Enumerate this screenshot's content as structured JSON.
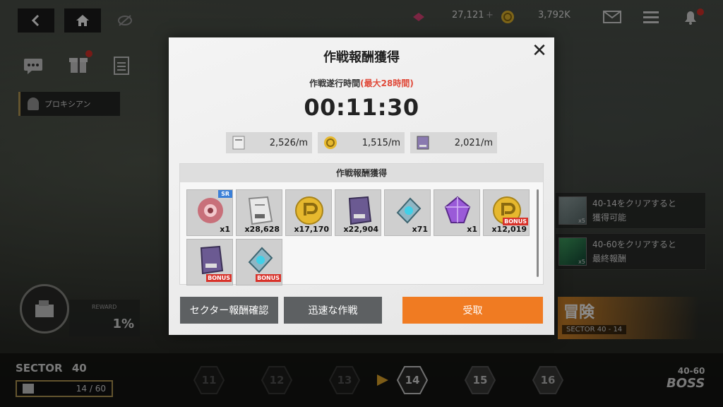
{
  "topbar": {
    "gem_amount": "27,121",
    "plus": "+",
    "credit_amount": "3,792K"
  },
  "side": {
    "proxy_label": "プロキシアン"
  },
  "reward_panel": {
    "label": "REWARD",
    "percent": "1%"
  },
  "missions": [
    {
      "text_line1": "40-14をクリアすると",
      "text_line2": "獲得可能",
      "count": "x5"
    },
    {
      "text_line1": "40-60をクリアすると",
      "text_line2": "最終報酬",
      "count": "x5"
    }
  ],
  "adventure": {
    "title": "冒険",
    "sector": "SECTOR 40 - 14"
  },
  "sector": {
    "label": "SECTOR",
    "number": "40",
    "progress": "14 / 60",
    "stages": [
      "11",
      "12",
      "13",
      "14",
      "15",
      "16"
    ],
    "boss_range": "40-60",
    "boss_label": "BOSS"
  },
  "modal": {
    "title": "作戦報酬獲得",
    "time_caption": "作戦遂行時間",
    "time_max": "(最大28時間)",
    "timer": "00:11:30",
    "rates": [
      {
        "icon": "exp-book-icon",
        "value": "2,526/m"
      },
      {
        "icon": "credit-coin-icon",
        "value": "1,515/m"
      },
      {
        "icon": "character-exp-icon",
        "value": "2,021/m"
      }
    ],
    "rewards_header": "作戦報酬獲得",
    "items": [
      {
        "icon": "sr-module-icon",
        "qty": "x1",
        "badge": "SR"
      },
      {
        "icon": "exp-book-icon",
        "qty": "x28,628"
      },
      {
        "icon": "credit-coin-icon",
        "qty": "x17,170"
      },
      {
        "icon": "character-exp-icon",
        "qty": "x22,904"
      },
      {
        "icon": "core-dust-icon",
        "qty": "x71"
      },
      {
        "icon": "purple-gem-icon",
        "qty": "x1"
      },
      {
        "icon": "credit-coin-icon",
        "qty": "x12,019",
        "bonus": "BONUS"
      },
      {
        "icon": "character-exp-icon",
        "qty": "",
        "bonus": "BONUS"
      },
      {
        "icon": "core-dust-icon",
        "qty": "",
        "bonus": "BONUS"
      }
    ],
    "buttons": {
      "sector_rewards": "セクター報酬確認",
      "quick_battle": "迅速な作戦",
      "receive": "受取"
    }
  },
  "colors": {
    "accent_orange": "#f07b22",
    "max_red": "#e04a3a",
    "bonus_red": "#d8322a",
    "sr_blue": "#3a7fd8"
  }
}
